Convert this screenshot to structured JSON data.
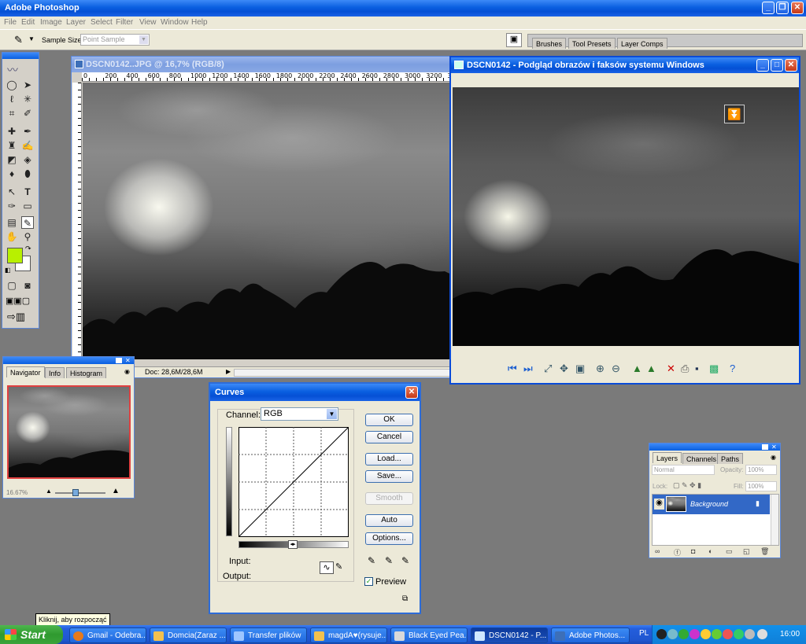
{
  "app": {
    "title": "Adobe Photoshop",
    "menu": [
      "File",
      "Edit",
      "Image",
      "Layer",
      "Select",
      "Filter",
      "View",
      "Window",
      "Help"
    ]
  },
  "options_bar": {
    "sample_size_label": "Sample Size:",
    "sample_size_value": "Point Sample",
    "palette_tabs": [
      "Brushes",
      "Tool Presets",
      "Layer Comps"
    ]
  },
  "document": {
    "title": "DSCN0142..JPG @ 16,7% (RGB/8)",
    "ruler_labels": [
      "0",
      "200",
      "400",
      "600",
      "800",
      "1000",
      "1200",
      "1400",
      "1600",
      "1800",
      "2000",
      "2200",
      "2400",
      "2600",
      "2800",
      "3000",
      "3200",
      "340"
    ],
    "status": "Doc: 28,6M/28,6M"
  },
  "viewer": {
    "title": "DSCN0142 - Podgląd obrazów i faksów systemu Windows"
  },
  "navigator": {
    "tabs": [
      "Navigator",
      "Info",
      "Histogram"
    ],
    "zoom": "16.67%"
  },
  "curves": {
    "title": "Curves",
    "channel_label": "Channel:",
    "channel_value": "RGB",
    "buttons": [
      "OK",
      "Cancel",
      "Load...",
      "Save...",
      "Smooth",
      "Auto",
      "Options..."
    ],
    "input_label": "Input:",
    "output_label": "Output:",
    "preview_label": "Preview",
    "preview_checked": true
  },
  "layers": {
    "tabs": [
      "Layers",
      "Channels",
      "Paths"
    ],
    "blend_mode": "Normal",
    "opacity_label": "Opacity:",
    "opacity_value": "100%",
    "lock_label": "Lock:",
    "fill_label": "Fill:",
    "fill_value": "100%",
    "layer_name": "Background"
  },
  "taskbar": {
    "tooltip": "Kliknij, aby rozpocząć",
    "start_label": "Start",
    "buttons": [
      "Gmail - Odebra...",
      "Domcia(Zaraz ...",
      "Transfer plików",
      "magdA♥(rysuje...",
      "Black Eyed Pea...",
      "DSCN0142 - P...",
      "Adobe Photos..."
    ],
    "language": "PL",
    "clock": "16:00"
  },
  "colors": {
    "foreground": "#b8f000",
    "background": "#ffffff",
    "xp_blue": "#0a5fe0"
  }
}
